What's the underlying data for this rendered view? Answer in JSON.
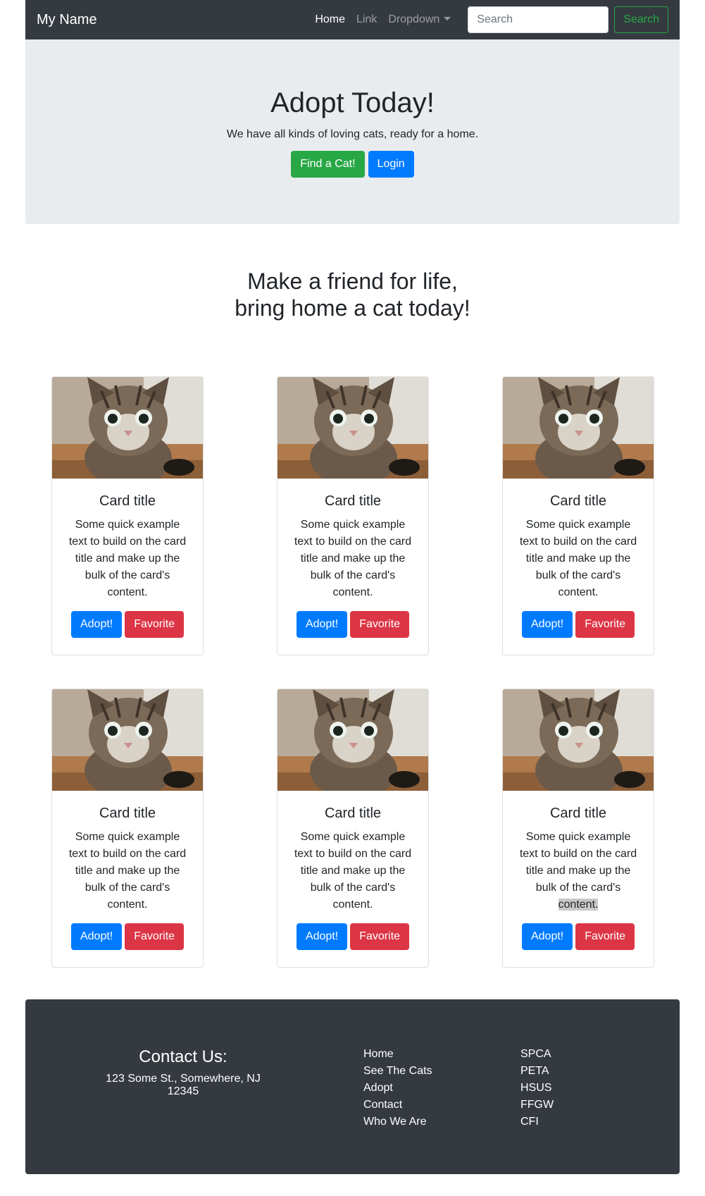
{
  "navbar": {
    "brand": "My Name",
    "links": [
      "Home",
      "Link",
      "Dropdown"
    ],
    "search_placeholder": "Search",
    "search_button": "Search"
  },
  "hero": {
    "title": "Adopt Today!",
    "subtitle": "We have all kinds of loving cats, ready for a home.",
    "find_button": "Find a Cat!",
    "login_button": "Login"
  },
  "tagline": {
    "line1": "Make a friend for life,",
    "line2": "bring home a cat today!"
  },
  "cards": [
    {
      "title": "Card title",
      "text": "Some quick example text to build on the card title and make up the bulk of the card's ",
      "text_end": "content.",
      "adopt": "Adopt!",
      "favorite": "Favorite"
    },
    {
      "title": "Card title",
      "text": "Some quick example text to build on the card title and make up the bulk of the card's ",
      "text_end": "content.",
      "adopt": "Adopt!",
      "favorite": "Favorite"
    },
    {
      "title": "Card title",
      "text": "Some quick example text to build on the card title and make up the bulk of the card's ",
      "text_end": "content.",
      "adopt": "Adopt!",
      "favorite": "Favorite"
    },
    {
      "title": "Card title",
      "text": "Some quick example text to build on the card title and make up the bulk of the card's ",
      "text_end": "content.",
      "adopt": "Adopt!",
      "favorite": "Favorite"
    },
    {
      "title": "Card title",
      "text": "Some quick example text to build on the card title and make up the bulk of the card's ",
      "text_end": "content.",
      "adopt": "Adopt!",
      "favorite": "Favorite"
    },
    {
      "title": "Card title",
      "text": "Some quick example text to build on the card title and make up the bulk of the card's ",
      "text_end": "content.",
      "adopt": "Adopt!",
      "favorite": "Favorite"
    }
  ],
  "footer": {
    "contact_title": "Contact Us:",
    "address": "123 Some St., Somewhere, NJ 12345",
    "nav_links": [
      "Home",
      "See The Cats",
      "Adopt",
      "Contact",
      "Who We Are"
    ],
    "org_links": [
      "SPCA",
      "PETA",
      "HSUS",
      "FFGW",
      "CFI"
    ]
  },
  "colors": {
    "navbar_bg": "#343a40",
    "jumbotron_bg": "#e9ecef",
    "primary": "#007bff",
    "success": "#28a745",
    "danger": "#dc3545"
  }
}
